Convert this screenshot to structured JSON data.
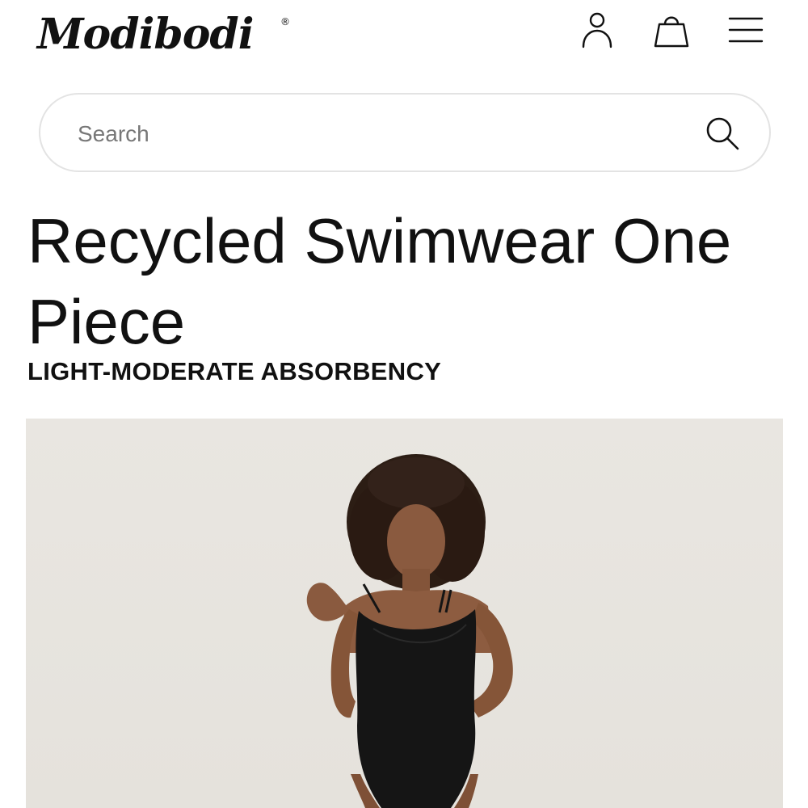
{
  "header": {
    "logo_text": "Modibodi",
    "logo_registered": "®",
    "icons": {
      "account": "user-icon",
      "bag": "shopping-bag-icon",
      "menu": "hamburger-menu-icon"
    }
  },
  "search": {
    "placeholder": "Search",
    "value": "",
    "icon": "search-icon"
  },
  "product": {
    "title": "Recycled Swimwear One Piece",
    "absorbency": "LIGHT-MODERATE ABSORBENCY",
    "image_description": "Model wearing black one-piece swimsuit"
  },
  "colors": {
    "text": "#111111",
    "search_border": "#e3e3e3",
    "image_background": "#e7e4df",
    "swimsuit": "#151515"
  }
}
